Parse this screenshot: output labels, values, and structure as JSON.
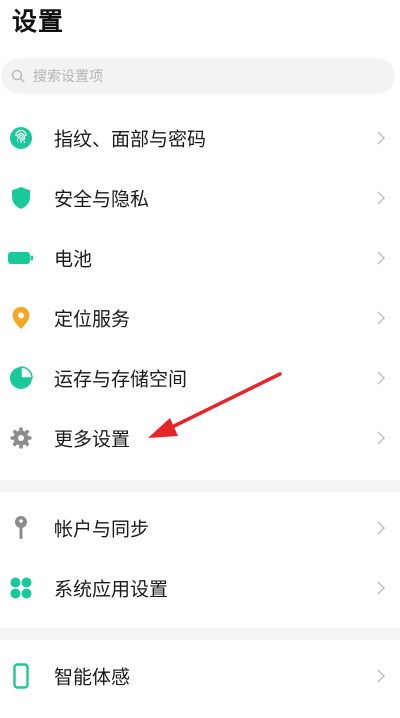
{
  "header": {
    "title": "设置"
  },
  "search": {
    "placeholder": "搜索设置项"
  },
  "colors": {
    "accent": "#18c99a",
    "location": "#f5a623",
    "gray_icon": "#8c8c8c",
    "annotation_arrow": "#e8242b"
  },
  "settings": {
    "group1": [
      {
        "label": "指纹、面部与密码",
        "icon": "fingerprint-icon"
      },
      {
        "label": "安全与隐私",
        "icon": "shield-icon"
      },
      {
        "label": "电池",
        "icon": "battery-icon"
      },
      {
        "label": "定位服务",
        "icon": "location-pin-icon"
      },
      {
        "label": "运存与存储空间",
        "icon": "pie-chart-icon"
      },
      {
        "label": "更多设置",
        "icon": "gear-icon"
      }
    ],
    "group2": [
      {
        "label": "帐户与同步",
        "icon": "key-icon"
      },
      {
        "label": "系统应用设置",
        "icon": "apps-grid-icon"
      }
    ],
    "group3": [
      {
        "label": "智能体感",
        "icon": "phone-outline-icon"
      }
    ]
  },
  "annotation": {
    "icon": "red-arrow-icon",
    "target": "更多设置"
  }
}
